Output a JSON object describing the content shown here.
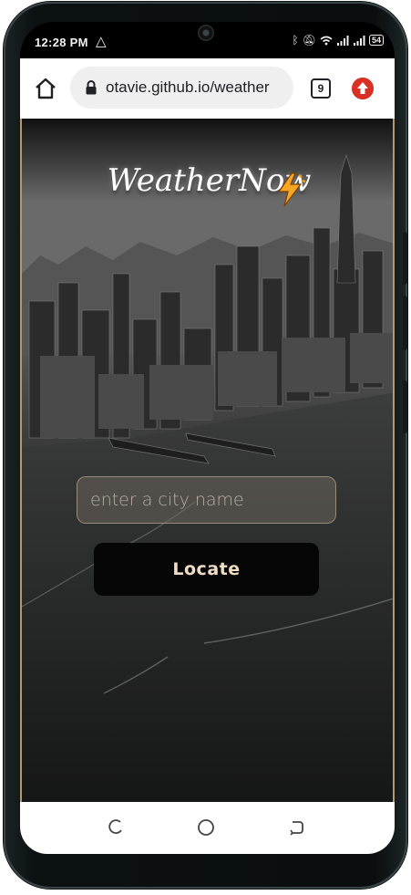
{
  "status_bar": {
    "time": "12:28 PM",
    "battery": "54",
    "icons": [
      "alert-triangle-icon",
      "bluetooth-icon",
      "mute-icon",
      "wifi-icon",
      "signal-icon",
      "signal-icon",
      "battery-icon"
    ]
  },
  "browser": {
    "url": "otavie.github.io/weather",
    "tab_count": "9",
    "icons": [
      "home-icon",
      "lock-icon",
      "update-icon"
    ],
    "accent_color": "#d93025"
  },
  "page": {
    "title": "WeatherNow",
    "title_icon": "lightning-bolt-icon",
    "search": {
      "placeholder": "enter a city name",
      "value": ""
    },
    "locate_label": "Locate",
    "colors": {
      "button_text": "#f0ddc4",
      "border_accent": "#b49a72"
    }
  },
  "nav_bar": {
    "icons": [
      "recent-apps-icon",
      "home-circle-icon",
      "back-icon"
    ]
  }
}
